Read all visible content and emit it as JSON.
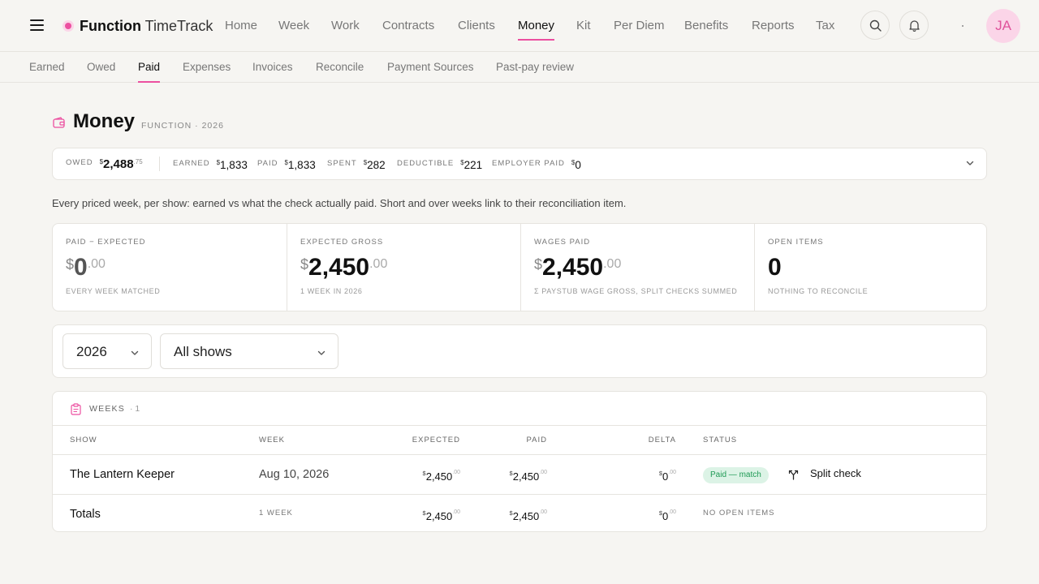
{
  "app": {
    "brand_bold": "Function",
    "brand_light": "TimeTrack",
    "avatar_initials": "JA"
  },
  "nav": [
    {
      "label": "Home"
    },
    {
      "label": "Week"
    },
    {
      "label": "Work"
    },
    {
      "label": "Contracts"
    },
    {
      "label": "Clients"
    },
    {
      "label": "Money",
      "active": true
    },
    {
      "label": "Kit"
    },
    {
      "label": "Per Diem"
    },
    {
      "label": "Benefits"
    },
    {
      "label": "Reports"
    },
    {
      "label": "Tax"
    }
  ],
  "subnav": [
    {
      "label": "Earned"
    },
    {
      "label": "Owed"
    },
    {
      "label": "Paid",
      "active": true
    },
    {
      "label": "Expenses"
    },
    {
      "label": "Invoices"
    },
    {
      "label": "Reconcile"
    },
    {
      "label": "Payment Sources"
    },
    {
      "label": "Past-pay review"
    }
  ],
  "page": {
    "title": "Money",
    "subtitle": "FUNCTION · 2026",
    "description": "Every priced week, per show: earned vs what the check actually paid. Short and over weeks link to their reconciliation item."
  },
  "summary": {
    "owed": {
      "label": "OWED",
      "currency": "$",
      "value": "2,488",
      "cents": ".75"
    },
    "earned": {
      "label": "EARNED",
      "currency": "$",
      "value": "1,833"
    },
    "paid": {
      "label": "PAID",
      "currency": "$",
      "value": "1,833"
    },
    "spent": {
      "label": "SPENT",
      "currency": "$",
      "value": "282"
    },
    "deductible": {
      "label": "DEDUCTIBLE",
      "currency": "$",
      "value": "221"
    },
    "employer_paid": {
      "label": "EMPLOYER PAID",
      "currency": "$",
      "value": "0"
    }
  },
  "kpis": [
    {
      "label": "PAID − EXPECTED",
      "currency": "$",
      "value": "0",
      "cents": ".00",
      "note": "EVERY WEEK MATCHED"
    },
    {
      "label": "EXPECTED GROSS",
      "currency": "$",
      "value": "2,450",
      "cents": ".00",
      "note": "1 WEEK IN 2026"
    },
    {
      "label": "WAGES PAID",
      "currency": "$",
      "value": "2,450",
      "cents": ".00",
      "note": "Σ PAYSTUB WAGE GROSS, SPLIT CHECKS SUMMED"
    },
    {
      "label": "OPEN ITEMS",
      "currency": "",
      "value": "0",
      "cents": "",
      "note": "NOTHING TO RECONCILE"
    }
  ],
  "filters": {
    "year": "2026",
    "show": "All shows"
  },
  "weeks": {
    "title": "WEEKS",
    "count": "· 1",
    "columns": {
      "show": "SHOW",
      "week": "WEEK",
      "expected": "EXPECTED",
      "paid": "PAID",
      "delta": "DELTA",
      "status": "STATUS"
    },
    "rows": [
      {
        "show": "The Lantern Keeper",
        "week": "Aug 10, 2026",
        "expected": {
          "currency": "$",
          "value": "2,450",
          "cents": ".00"
        },
        "paid": {
          "currency": "$",
          "value": "2,450",
          "cents": ".00"
        },
        "delta": {
          "currency": "$",
          "value": "0",
          "cents": ".00"
        },
        "status": "Paid — match",
        "action": "Split check"
      }
    ],
    "totals": {
      "label": "Totals",
      "weeks": "1 WEEK",
      "expected": {
        "currency": "$",
        "value": "2,450",
        "cents": ".00"
      },
      "paid": {
        "currency": "$",
        "value": "2,450",
        "cents": ".00"
      },
      "delta": {
        "currency": "$",
        "value": "0",
        "cents": ".00"
      },
      "status": "NO OPEN ITEMS"
    }
  },
  "colors": {
    "accent": "#ec4fa0",
    "accent_soft": "#fbd5e8",
    "success": "#1f9a55",
    "success_soft": "#dcf3e6",
    "background": "#f6f5f2"
  },
  "icons": [
    "menu-icon",
    "search-icon",
    "bell-icon",
    "wallet-icon",
    "chevron-down-icon",
    "clipboard-icon",
    "split-icon"
  ]
}
